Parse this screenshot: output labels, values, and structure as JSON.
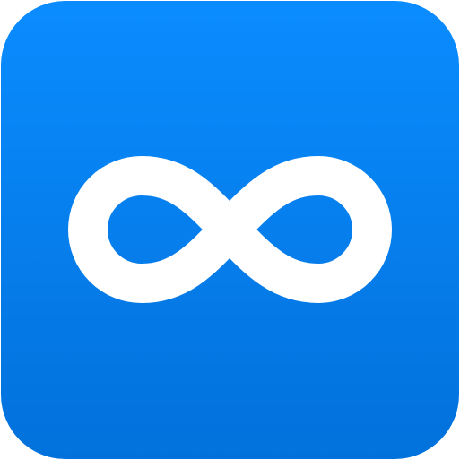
{
  "icon": {
    "name": "infinity-icon",
    "colors": {
      "gradient_top": "#0A8CFF",
      "gradient_bottom": "#0271DB",
      "symbol": "#FFFFFF"
    }
  }
}
